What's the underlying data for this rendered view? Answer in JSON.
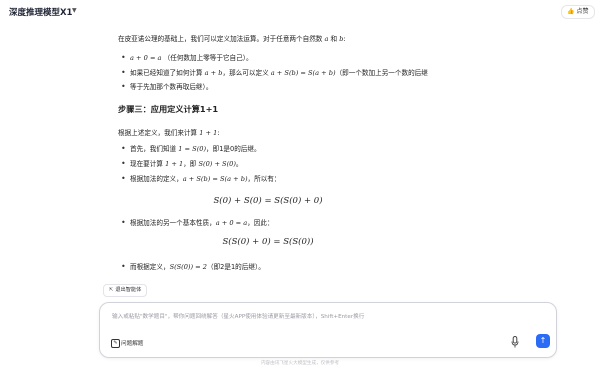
{
  "header": {
    "model_title": "深度推理模型X1",
    "chevron_icon": "chevron-down-icon",
    "share_label": "点赞",
    "share_icon": "thumb-up-icon"
  },
  "content": {
    "intro": {
      "prefix": "在皮亚诺公理的基础上，我们可以定义加法运算。对于任意两个自然数 ",
      "a": "a",
      "mid": " 和 ",
      "b": "b",
      "suffix": ":"
    },
    "bullet1": {
      "math": "a + 0 = a",
      "text": "（任何数加上零等于它自己）。"
    },
    "bullet2": {
      "pre": "如果已经知道了如何计算 ",
      "m1": "a + b",
      "mid": "，那么可以定义 ",
      "m2": "a + S(b) = S(a + b)",
      "post": "（即一个数加上另一个数的后继",
      "cont": "等于先加那个数再取后继）。"
    },
    "step_heading": "步骤三：应用定义计算1+1",
    "calc_intro": {
      "text": "根据上述定义，我们来计算 ",
      "math": "1 + 1",
      "suffix": ":"
    },
    "b3": {
      "pre": "首先，我们知道 ",
      "math": "1 = S(0)",
      "post": "，即1是0的后继。"
    },
    "b4": {
      "pre": "现在要计算 ",
      "m1": "1 + 1",
      "mid": "，即 ",
      "m2": "S(0) + S(0)",
      "post": "。"
    },
    "b5": {
      "pre": "根据加法的定义，",
      "math": "a + S(b) = S(a + b)",
      "post": "，所以有："
    },
    "eq1": "S(0) + S(0) = S(S(0) + 0)",
    "b6": {
      "pre": "根据加法的另一个基本性质，",
      "math": "a + 0 = a",
      "post": "，因此："
    },
    "eq2": "S(S(0) + 0) = S(S(0))",
    "b7": {
      "pre": "而根据定义，",
      "math": "S(S(0)) = 2",
      "post": "（即2是1的后继）。"
    }
  },
  "followup": {
    "label": "退出智能体",
    "icon": "exit-icon"
  },
  "input": {
    "placeholder": "输入或粘贴\"数学题目\"，帮你问题回绕解答（星火APP使用体验请更新至最新版本），Shift+Enter换行",
    "tool_label": "问题解题",
    "tool_icon": "edit-icon",
    "mic_icon": "microphone-icon",
    "send_icon": "send-arrow-icon"
  },
  "footer": "内容由讯飞星火大模型生成，仅供参考",
  "colors": {
    "accent": "#2b6cf6",
    "text": "#222222",
    "border": "#d2d2da"
  }
}
